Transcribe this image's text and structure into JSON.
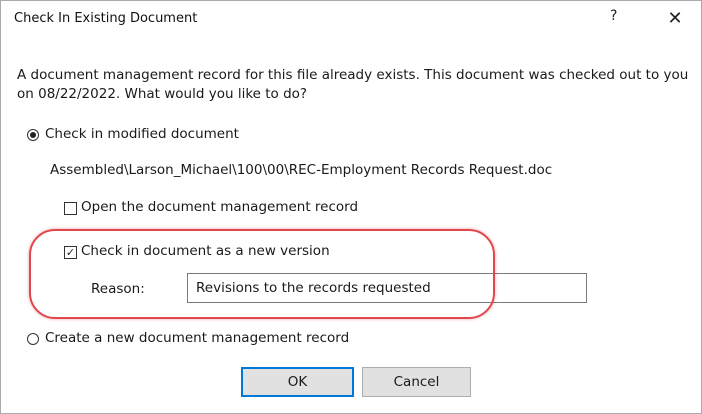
{
  "window": {
    "title": "Check In Existing Document",
    "help_glyph": "?",
    "close_glyph": "✕"
  },
  "message": "A document management record for this file already exists.  This document was checked out to you on 08/22/2022.  What would you like to do?",
  "options": {
    "check_in_modified": {
      "label": "Check in modified document",
      "selected": true
    },
    "file_path": "Assembled\\Larson_Michael\\100\\00\\REC-Employment Records Request.doc",
    "open_record": {
      "label": "Open the document management record",
      "checked": false
    },
    "new_version": {
      "label": "Check in document as a new version",
      "checked": true,
      "check_glyph": "✓"
    },
    "reason": {
      "label": "Reason:",
      "value": "Revisions to the records requested"
    },
    "create_new_record": {
      "label": "Create a new document management record",
      "selected": false
    }
  },
  "buttons": {
    "ok": "OK",
    "cancel": "Cancel"
  },
  "colors": {
    "highlight": "#e0484e",
    "default_button_border": "#0078d7"
  }
}
